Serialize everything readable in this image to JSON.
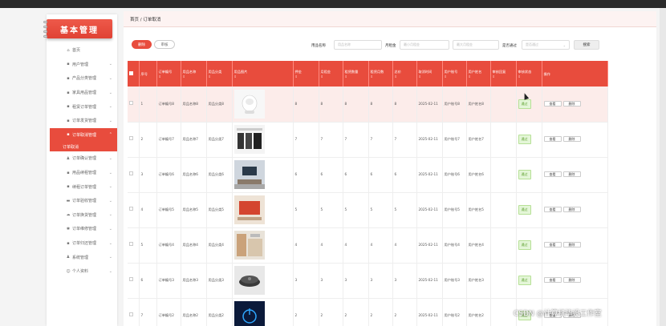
{
  "app": {
    "logo_text": "基本管理"
  },
  "breadcrumb": {
    "text": "首页 / 订单取消"
  },
  "sidebar": {
    "items": [
      {
        "icon": "home-icon",
        "glyph": "⌂",
        "label": "首页",
        "chevron": ""
      },
      {
        "icon": "grid-icon",
        "glyph": "▪",
        "label": "用户管理",
        "chevron": "⌄"
      },
      {
        "icon": "grid-icon",
        "glyph": "▪",
        "label": "产品分类管理",
        "chevron": "⌄"
      },
      {
        "icon": "grid-icon",
        "glyph": "▪",
        "label": "家具用品管理",
        "chevron": "⌄"
      },
      {
        "icon": "grid-icon",
        "glyph": "▪",
        "label": "租赁订单管理",
        "chevron": "⌄"
      },
      {
        "icon": "grid-icon",
        "glyph": "▪",
        "label": "订单发货管理",
        "chevron": "⌄"
      },
      {
        "icon": "grid-icon",
        "glyph": "▪",
        "label": "订单取消管理",
        "chevron": "⌃",
        "active": true
      },
      {
        "icon": "user-icon",
        "glyph": "♟",
        "label": "订单确认管理",
        "chevron": "⌄"
      },
      {
        "icon": "grid-icon",
        "glyph": "▪",
        "label": "用品续租管理",
        "chevron": "⌄"
      },
      {
        "icon": "grid-icon",
        "glyph": "▪",
        "label": "续租订单管理",
        "chevron": "⌄"
      },
      {
        "icon": "chat-icon",
        "glyph": "▬",
        "label": "订单验收管理",
        "chevron": "⌄"
      },
      {
        "icon": "cloud-icon",
        "glyph": "☁",
        "label": "订单换货管理",
        "chevron": "⌄"
      },
      {
        "icon": "gear-icon",
        "glyph": "✱",
        "label": "订单维修管理",
        "chevron": "⌄"
      },
      {
        "icon": "grid-icon",
        "glyph": "▪",
        "label": "订单归还管理",
        "chevron": "⌄"
      },
      {
        "icon": "user-icon",
        "glyph": "♟",
        "label": "系统管理",
        "chevron": "⌄"
      },
      {
        "icon": "person-icon",
        "glyph": "☺",
        "label": "个人资料",
        "chevron": "⌄"
      }
    ],
    "submenu_label": "订单取消"
  },
  "toolbar": {
    "delete_label": "删除",
    "audit_label": "审核",
    "search_label": "搜索"
  },
  "filters": {
    "name_label": "用品名称",
    "name_placeholder": "用品名称",
    "rent_label": "月租金",
    "min_placeholder": "最小月租金",
    "max_placeholder": "最大月租金",
    "pass_label": "是否通过",
    "pass_placeholder": "是否通过"
  },
  "table": {
    "headers": [
      "序号",
      "订单编号",
      "用品名称",
      "用品分类",
      "用品图片",
      "押金",
      "月租金",
      "租赁数量",
      "租赁月数",
      "总价",
      "取消时间",
      "用户账号",
      "用户姓名",
      "审核回复",
      "审核状态",
      "操作"
    ],
    "sort_glyph": "⇕",
    "rows": [
      {
        "idx": "1",
        "order": "订单编号8",
        "name": "用品名称8",
        "cat": "用品分类8",
        "img": "speaker",
        "deposit": "8",
        "rent": "8",
        "qty": "8",
        "months": "8",
        "total": "8",
        "time": "2025-02-11",
        "account": "用户账号8",
        "uname": "用户姓名8",
        "reply": "",
        "status": "通过"
      },
      {
        "idx": "2",
        "order": "订单编号7",
        "name": "用品名称7",
        "cat": "用品分类7",
        "img": "panels",
        "deposit": "7",
        "rent": "7",
        "qty": "7",
        "months": "7",
        "total": "7",
        "time": "2025-02-11",
        "account": "用户账号7",
        "uname": "用户姓名7",
        "reply": "",
        "status": "通过"
      },
      {
        "idx": "3",
        "order": "订单编号6",
        "name": "用品名称6",
        "cat": "用品分类6",
        "img": "tvwall",
        "deposit": "6",
        "rent": "6",
        "qty": "6",
        "months": "6",
        "total": "6",
        "time": "2025-02-11",
        "account": "用户账号6",
        "uname": "用户姓名6",
        "reply": "",
        "status": "通过"
      },
      {
        "idx": "4",
        "order": "订单编号5",
        "name": "用品名称5",
        "cat": "用品分类5",
        "img": "tv",
        "deposit": "5",
        "rent": "5",
        "qty": "5",
        "months": "5",
        "total": "5",
        "time": "2025-02-11",
        "account": "用户账号5",
        "uname": "用户姓名5",
        "reply": "",
        "status": "通过"
      },
      {
        "idx": "5",
        "order": "订单编号4",
        "name": "用品名称4",
        "cat": "用品分类4",
        "img": "kitchen",
        "deposit": "4",
        "rent": "4",
        "qty": "4",
        "months": "4",
        "total": "4",
        "time": "2025-02-11",
        "account": "用户账号4",
        "uname": "用户姓名4",
        "reply": "",
        "status": "通过"
      },
      {
        "idx": "6",
        "order": "订单编号3",
        "name": "用品名称3",
        "cat": "用品分类3",
        "img": "robot",
        "deposit": "3",
        "rent": "3",
        "qty": "3",
        "months": "3",
        "total": "3",
        "time": "2025-02-11",
        "account": "用户账号3",
        "uname": "用户姓名3",
        "reply": "",
        "status": "通过"
      },
      {
        "idx": "7",
        "order": "订单编号2",
        "name": "用品名称2",
        "cat": "用品分类2",
        "img": "power",
        "deposit": "2",
        "rent": "2",
        "qty": "2",
        "months": "2",
        "total": "2",
        "time": "2025-02-11",
        "account": "用户账号2",
        "uname": "用户姓名2",
        "reply": "",
        "status": "通过"
      }
    ],
    "view_label": "查看",
    "delete_label": "删除"
  },
  "watermark": "CSDN @计算机毕设工作室"
}
